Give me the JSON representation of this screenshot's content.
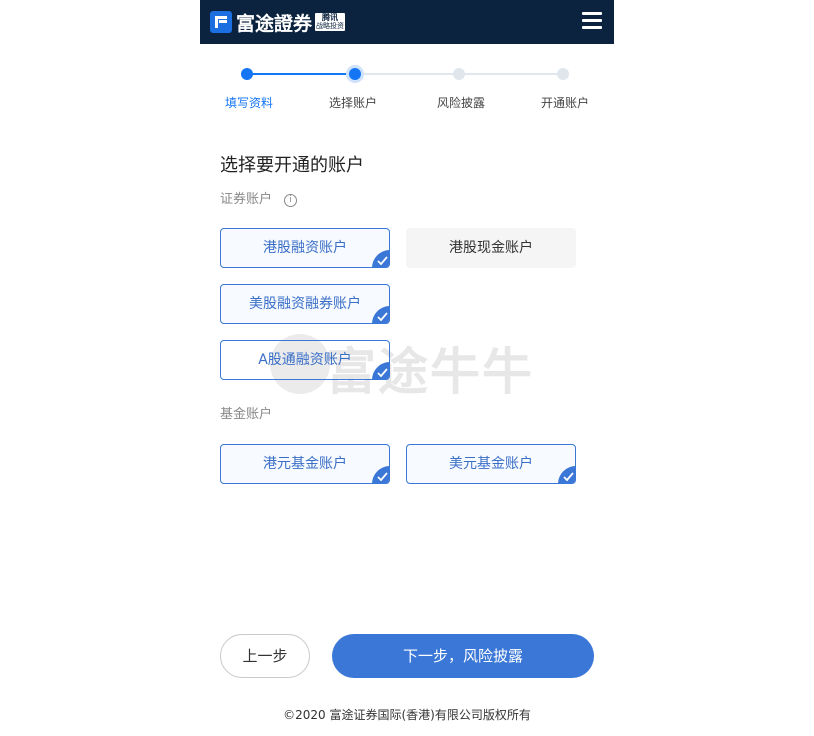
{
  "header": {
    "logo_text": "富途證券",
    "logo_badge_line1": "腾讯",
    "logo_badge_line2": "战略投资"
  },
  "stepper": {
    "steps": [
      {
        "label": "填写资料",
        "state": "done"
      },
      {
        "label": "选择账户",
        "state": "current"
      },
      {
        "label": "风险披露",
        "state": "todo"
      },
      {
        "label": "开通账户",
        "state": "todo"
      }
    ]
  },
  "main": {
    "title": "选择要开通的账户",
    "securities_label": "证券账户",
    "info_icon_glyph": "i",
    "securities_accounts": [
      {
        "label": "港股融资账户",
        "selected": true
      },
      {
        "label": "港股现金账户",
        "selected": false
      },
      {
        "label": "美股融资融券账户",
        "selected": true
      },
      {
        "label": "A股通融资账户",
        "selected": true
      }
    ],
    "fund_label": "基金账户",
    "fund_accounts": [
      {
        "label": "港元基金账户",
        "selected": true
      },
      {
        "label": "美元基金账户",
        "selected": true
      }
    ],
    "watermark_text": "富途牛牛"
  },
  "actions": {
    "prev_label": "上一步",
    "next_label": "下一步，风险披露"
  },
  "footer": {
    "copyright": "©2020 富途证券国际(香港)有限公司版权所有"
  },
  "colors": {
    "header_bg": "#0c2340",
    "accent": "#3a77d6",
    "step_active": "#1476f5"
  },
  "icons": {
    "menu": "hamburger-menu-icon",
    "check": "checkmark-corner-icon",
    "info": "info-circle-icon"
  }
}
